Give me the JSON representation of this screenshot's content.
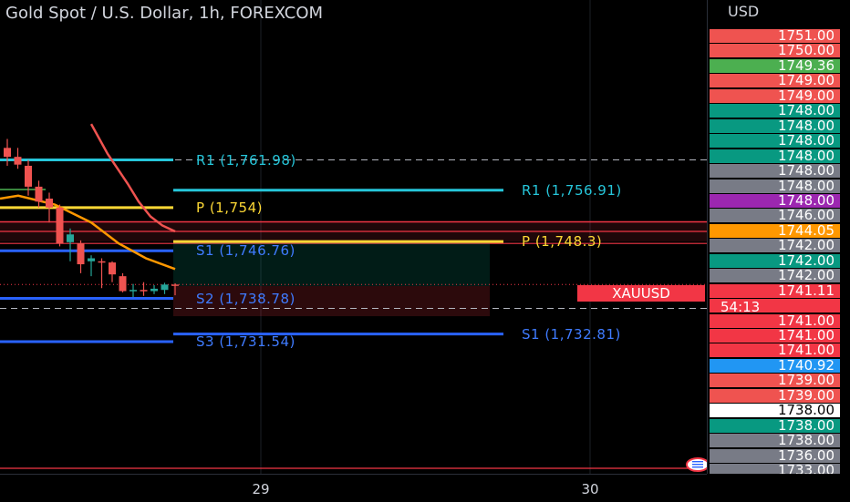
{
  "title": "Gold Spot / U.S. Dollar, 1h, FOREXCOM",
  "currency": "USD",
  "symbol": "XAUUSD",
  "current_price": "1741.11",
  "countdown": "54:13",
  "colors": {
    "up": "#26a69a",
    "down": "#ef5350",
    "pivot": "#fdd835",
    "resistance": "#26c6da",
    "support": "#2962ff",
    "band": "#f23645",
    "fast_ma": "#ef5350",
    "slow_ma": "#ff9800"
  },
  "levels": [
    {
      "label": "R1 (1,761.98)",
      "price": 1761.98,
      "kind": "resistance",
      "segment": "left"
    },
    {
      "label": "R1 (1,756.91)",
      "price": 1756.91,
      "kind": "resistance",
      "segment": "right"
    },
    {
      "label": "P (1,754)",
      "price": 1754,
      "kind": "pivot",
      "segment": "left"
    },
    {
      "label": "P (1,748.3)",
      "price": 1748.3,
      "kind": "pivot",
      "segment": "right"
    },
    {
      "label": "S1 (1,746.76)",
      "price": 1746.76,
      "kind": "support",
      "segment": "left"
    },
    {
      "label": "S2 (1,738.78)",
      "price": 1738.78,
      "kind": "support",
      "segment": "left"
    },
    {
      "label": "S1 (1,732.81)",
      "price": 1732.81,
      "kind": "support",
      "segment": "right"
    },
    {
      "label": "S3 (1,731.54)",
      "price": 1731.54,
      "kind": "support",
      "segment": "left"
    }
  ],
  "zone": {
    "top": 1751.6,
    "bottom": 1748.3
  },
  "position": {
    "entry": 1740.85,
    "target": 1748.3,
    "stop": 1735.8
  },
  "price_tags": [
    {
      "text": "1751.00",
      "color": "#ef5350"
    },
    {
      "text": "1750.00",
      "color": "#ef5350"
    },
    {
      "text": "1749.36",
      "color": "#4caf50"
    },
    {
      "text": "1749.00",
      "color": "#ef5350"
    },
    {
      "text": "1749.00",
      "color": "#ef5350"
    },
    {
      "text": "1748.00",
      "color": "#089981"
    },
    {
      "text": "1748.00",
      "color": "#089981"
    },
    {
      "text": "1748.00",
      "color": "#089981"
    },
    {
      "text": "1748.00",
      "color": "#089981"
    },
    {
      "text": "1748.00",
      "color": "#787b86"
    },
    {
      "text": "1748.00",
      "color": "#787b86"
    },
    {
      "text": "1748.00",
      "color": "#9c27b0"
    },
    {
      "text": "1746.00",
      "color": "#787b86"
    },
    {
      "text": "1744.05",
      "color": "#ff9800"
    },
    {
      "text": "1742.00",
      "color": "#787b86"
    },
    {
      "text": "1742.00",
      "color": "#089981"
    },
    {
      "text": "1742.00",
      "color": "#787b86"
    },
    {
      "text": "1741.11",
      "color": "#f23645"
    },
    {
      "text": "",
      "color": "#f23645"
    },
    {
      "text": "1741.00",
      "color": "#f23645"
    },
    {
      "text": "1741.00",
      "color": "#f23645"
    },
    {
      "text": "1741.00",
      "color": "#f23645"
    },
    {
      "text": "1740.92",
      "color": "#2196f3"
    },
    {
      "text": "1739.00",
      "color": "#ef5350"
    },
    {
      "text": "1739.00",
      "color": "#ef5350"
    },
    {
      "text": "1738.00",
      "color": "#ffffff",
      "text_color": "#000000"
    },
    {
      "text": "1738.00",
      "color": "#089981"
    },
    {
      "text": "1738.00",
      "color": "#787b86"
    },
    {
      "text": "1736.00",
      "color": "#787b86"
    },
    {
      "text": "1733.00",
      "color": "#787b86"
    }
  ],
  "time_labels": [
    {
      "text": "29"
    },
    {
      "text": "30"
    }
  ],
  "candles": [
    {
      "o": 1764.0,
      "h": 1765.5,
      "l": 1761.0,
      "c": 1762.5
    },
    {
      "o": 1762.5,
      "h": 1764.0,
      "l": 1760.5,
      "c": 1761.2
    },
    {
      "o": 1761.0,
      "h": 1762.0,
      "l": 1756.0,
      "c": 1757.5
    },
    {
      "o": 1757.5,
      "h": 1758.5,
      "l": 1754.0,
      "c": 1755.0
    },
    {
      "o": 1755.5,
      "h": 1756.5,
      "l": 1751.5,
      "c": 1754.0
    },
    {
      "o": 1754.0,
      "h": 1754.5,
      "l": 1747.5,
      "c": 1748.0
    },
    {
      "o": 1748.2,
      "h": 1750.5,
      "l": 1745.0,
      "c": 1749.5
    },
    {
      "o": 1748.0,
      "h": 1748.5,
      "l": 1743.0,
      "c": 1744.5
    },
    {
      "o": 1745.0,
      "h": 1746.0,
      "l": 1742.5,
      "c": 1745.5
    },
    {
      "o": 1745.0,
      "h": 1745.5,
      "l": 1740.5,
      "c": 1744.8
    },
    {
      "o": 1744.8,
      "h": 1745.0,
      "l": 1741.5,
      "c": 1742.8
    },
    {
      "o": 1742.5,
      "h": 1743.0,
      "l": 1739.8,
      "c": 1740.0
    },
    {
      "o": 1740.0,
      "h": 1741.2,
      "l": 1739.0,
      "c": 1740.2
    },
    {
      "o": 1740.2,
      "h": 1741.5,
      "l": 1739.2,
      "c": 1740.0
    },
    {
      "o": 1740.0,
      "h": 1741.0,
      "l": 1739.5,
      "c": 1740.4
    },
    {
      "o": 1740.2,
      "h": 1741.4,
      "l": 1739.5,
      "c": 1741.1
    },
    {
      "o": 1741.1,
      "h": 1741.3,
      "l": 1739.3,
      "c": 1740.9
    }
  ],
  "fast_ma": [
    1768,
    1763,
    1758,
    1755,
    1752.5,
    1751.0,
    1750.0
  ],
  "slow_ma": [
    1755.5,
    1756.0,
    1754.5,
    1751.5,
    1748.0,
    1745.5,
    1743.7
  ]
}
